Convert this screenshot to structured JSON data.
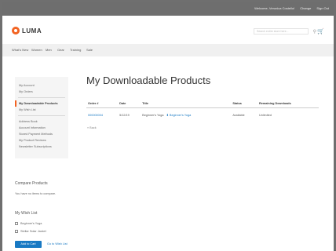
{
  "topbar": {
    "welcome": "Welcome, Veronica Costello!",
    "account_menu": "Change",
    "sign_out": "Sign Out"
  },
  "header": {
    "logo": "LUMA",
    "search_placeholder": "Search entire store here..."
  },
  "nav": {
    "items": [
      "What's New",
      "Women",
      "Men",
      "Gear",
      "Training",
      "Sale"
    ]
  },
  "sidebar": {
    "items": [
      "My Account",
      "My Orders",
      "My Downloadable Products",
      "My Wish List",
      "Address Book",
      "Account Information",
      "Stored Payment Methods",
      "My Product Reviews",
      "Newsletter Subscriptions"
    ],
    "active_index": 2
  },
  "main": {
    "title": "My Downloadable Products",
    "table": {
      "headers": [
        "Order #",
        "Date",
        "Title",
        "Status",
        "Remaining Downloads"
      ],
      "rows": [
        {
          "order": "000000004",
          "date": "5/12/19",
          "title": "Beginner's Yoga",
          "link": "Beginner's Yoga",
          "status": "Available",
          "remaining": "Unlimited"
        }
      ]
    },
    "back_link": "« Back"
  },
  "compare": {
    "title": "Compare Products",
    "text": "You have no items to compare."
  },
  "wishlist": {
    "title": "My Wish List",
    "items": [
      "Beginner's Yoga",
      "Stellar Solar Jacket"
    ],
    "add_all": "Add to Cart",
    "view_all": "Go to Wish List"
  }
}
